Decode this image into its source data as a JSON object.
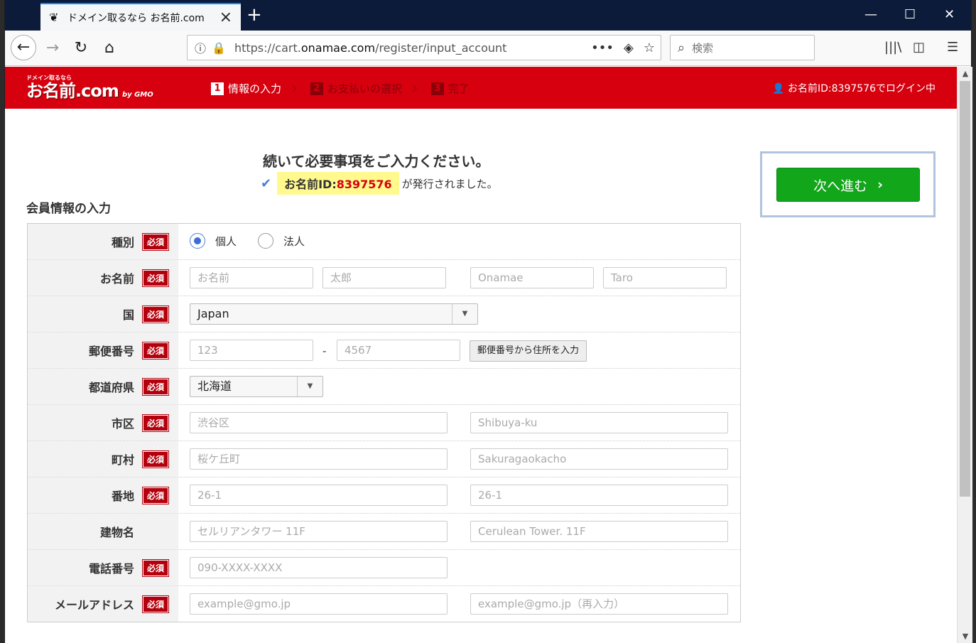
{
  "browser": {
    "tab_title": "ドメイン取るなら お名前.com",
    "new_tab": "+",
    "minimize": "—",
    "maximize": "☐",
    "close": "✕",
    "url_prefix": "https://cart.",
    "url_domain": "onamae.com",
    "url_path": "/register/input_account",
    "search_placeholder": "検索"
  },
  "header": {
    "logo_small": "ドメイン取るなら",
    "logo_big": "お名前.com",
    "logo_gmo": "by GMO",
    "steps": [
      {
        "num": "1",
        "label": "情報の入力"
      },
      {
        "num": "2",
        "label": "お支払いの選択"
      },
      {
        "num": "3",
        "label": "完了"
      }
    ],
    "login_text": "お名前ID:8397576でログイン中"
  },
  "main": {
    "headline": "続いて必要事項をご入力ください。",
    "id_label": "お名前ID:",
    "id_value": "8397576",
    "id_tail": "が発行されました。",
    "next_button": "次へ進む",
    "section_title": "会員情報の入力",
    "required_label": "必須"
  },
  "form": {
    "type": {
      "label": "種別",
      "options": [
        "個人",
        "法人"
      ],
      "selected": "個人"
    },
    "name": {
      "label": "お名前",
      "placeholders": [
        "お名前",
        "太郎",
        "Onamae",
        "Taro"
      ]
    },
    "country": {
      "label": "国",
      "value": "Japan"
    },
    "zip": {
      "label": "郵便番号",
      "placeholders": [
        "123",
        "4567"
      ],
      "dash": "-",
      "button": "郵便番号から住所を入力"
    },
    "prefecture": {
      "label": "都道府県",
      "value": "北海道"
    },
    "city": {
      "label": "市区",
      "placeholders": [
        "渋谷区",
        "Shibuya-ku"
      ]
    },
    "town": {
      "label": "町村",
      "placeholders": [
        "桜ケ丘町",
        "Sakuragaokacho"
      ]
    },
    "address": {
      "label": "番地",
      "placeholders": [
        "26-1",
        "26-1"
      ]
    },
    "building": {
      "label": "建物名",
      "placeholders": [
        "セルリアンタワー 11F",
        "Cerulean Tower. 11F"
      ]
    },
    "phone": {
      "label": "電話番号",
      "placeholders": [
        "090-XXXX-XXXX"
      ]
    },
    "email": {
      "label": "メールアドレス",
      "placeholders": [
        "example@gmo.jp",
        "example@gmo.jp（再入力）"
      ]
    }
  }
}
